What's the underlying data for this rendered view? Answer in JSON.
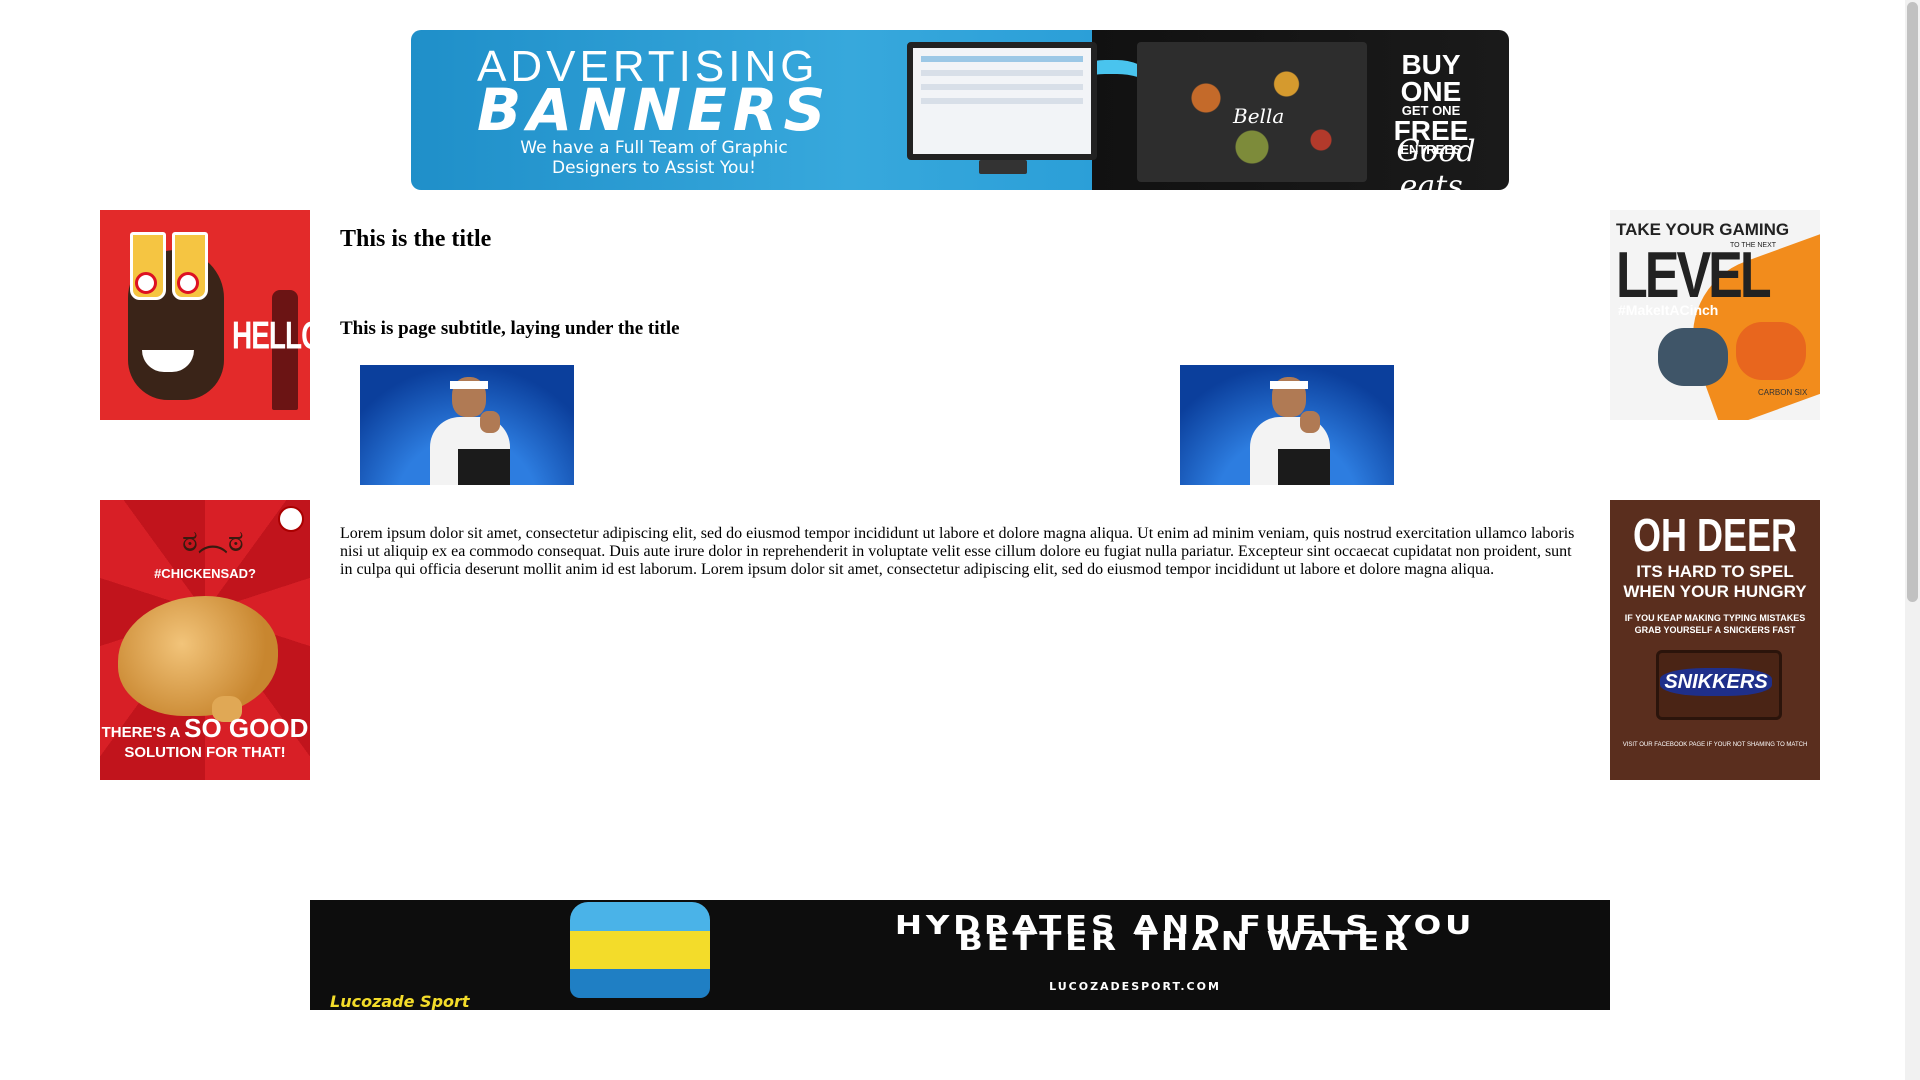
{
  "header_banner": {
    "line1": "ADVERTISING",
    "line2": "BANNERS",
    "tagline": "We have a Full Team of Graphic Designers to Assist You!",
    "offer_big": "BUY ONE",
    "offer_small": "GET ONE",
    "offer_big2": "FREE",
    "offer_small2": "ENTREES",
    "signoff": "Good eats.",
    "brand": "Bella"
  },
  "ads": {
    "top_left": {
      "text": "HELLO"
    },
    "top_right": {
      "line1": "TAKE YOUR GAMING",
      "line2": "LEVEL",
      "line3": "TO THE NEXT",
      "hashtag": "#MakeItACinch",
      "product": "CARBON SIX"
    },
    "bottom_left": {
      "hashtag": "#CHICKENSAD?",
      "face": "ಠ︵ಠ",
      "line1": "THERE'S A",
      "line1_big": "SO GOOD",
      "line2": "SOLUTION FOR THAT!"
    },
    "bottom_right": {
      "line1": "OH DEER",
      "line2": "ITS HARD TO SPEL",
      "line3": "WHEN YOUR HUNGRY",
      "line4": "IF YOU KEAP MAKING TYPING MISTAKES GRAB YOURSELF A SNICKERS FAST",
      "brand": "SNIKKERS",
      "footer": "VISIT OUR FACEBOOK PAGE IF YOUR NOT SHAMING TO MATCH"
    }
  },
  "content": {
    "title": "This is the title",
    "subtitle": "This is page subtitle, laying under the title",
    "body": "Lorem ipsum dolor sit amet, consectetur adipiscing elit, sed do eiusmod tempor incididunt ut labore et dolore magna aliqua. Ut enim ad minim veniam, quis nostrud exercitation ullamco laboris nisi ut aliquip ex ea commodo consequat. Duis aute irure dolor in reprehenderit in voluptate velit esse cillum dolore eu fugiat nulla pariatur. Excepteur sint occaecat cupidatat non proident, sunt in culpa qui officia deserunt mollit anim id est laborum. Lorem ipsum dolor sit amet, consectetur adipiscing elit, sed do eiusmod tempor incididunt ut labore et dolore magna aliqua."
  },
  "footer_banner": {
    "headline": "HYDRATES AND FUELS YOU BETTER THAN WATER",
    "url": "LUCOZADESPORT.COM",
    "brand": "Lucozade Sport"
  }
}
